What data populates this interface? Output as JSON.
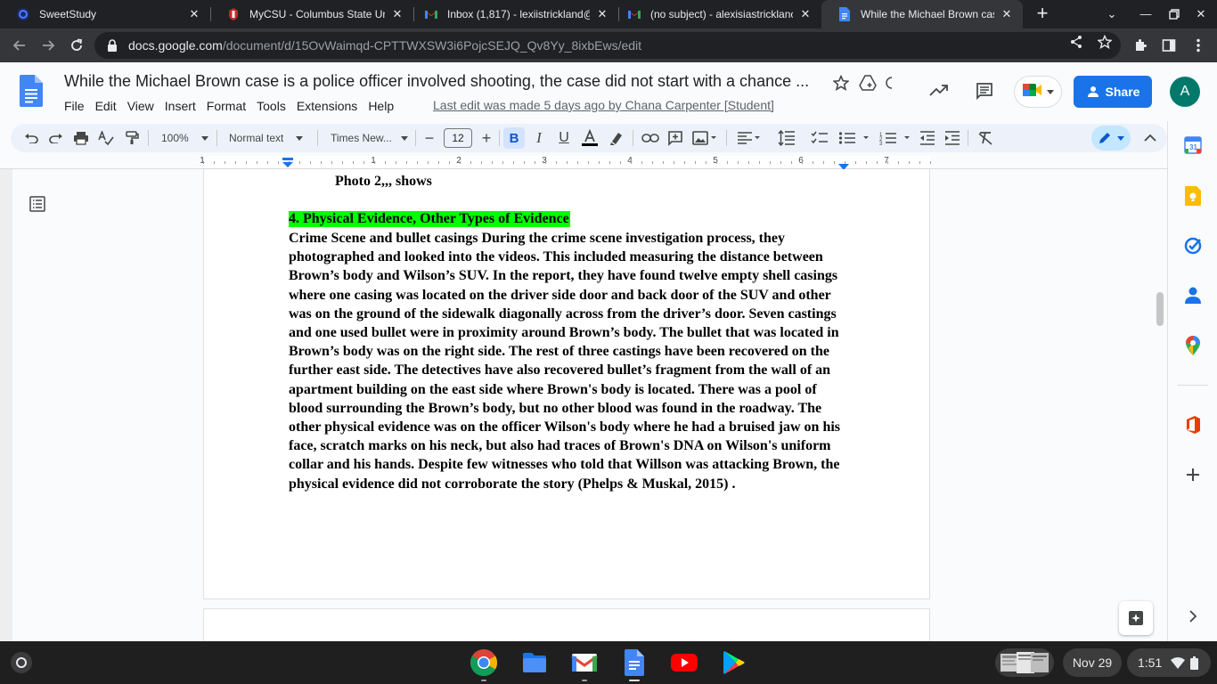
{
  "browser": {
    "tabs": [
      {
        "title": "SweetStudy",
        "icon": "sweetstudy-icon",
        "active": false
      },
      {
        "title": "MyCSU - Columbus State Univ",
        "icon": "csu-icon",
        "active": false
      },
      {
        "title": "Inbox (1,817) - lexiistrickland@",
        "icon": "gmail-icon",
        "active": false
      },
      {
        "title": "(no subject) - alexisiastricklanc",
        "icon": "gmail-icon",
        "active": false
      },
      {
        "title": "While the Michael Brown case",
        "icon": "docs-icon",
        "active": true
      }
    ],
    "url_host": "docs.google.com",
    "url_path": "/document/d/15OvWaimqd-CPTTWXSW3i6PojcSEJQ_Qv8Yy_8ixbEws/edit"
  },
  "docs": {
    "title": "While the Michael Brown case is a police officer involved shooting, the case did not start with a chance ...",
    "menu": [
      "File",
      "Edit",
      "View",
      "Insert",
      "Format",
      "Tools",
      "Extensions",
      "Help"
    ],
    "last_edit": "Last edit was made 5 days ago by Chana Carpenter [Student]",
    "share_label": "Share",
    "avatar_letter": "A",
    "toolbar": {
      "zoom": "100%",
      "style": "Normal text",
      "font": "Times New...",
      "font_size": "12",
      "bold": "B",
      "italic": "I",
      "underline": "U"
    },
    "ruler_numbers": [
      "1",
      "1",
      "2",
      "3",
      "4",
      "5",
      "6",
      "7"
    ]
  },
  "document": {
    "photo_line": "Photo 2,,, shows",
    "heading": "4. Physical Evidence, Other Types of Evidence",
    "body_lines": [
      "Crime Scene and bullet casings During the crime scene investigation process, they",
      "photographed and looked into the videos. This included measuring the distance between",
      "Brown’s body and Wilson’s SUV.  In the report, they have found twelve empty shell casings",
      "where one casing was located on the driver side door and back door of the SUV and other",
      "was on the ground of the sidewalk diagonally across from the driver’s door. Seven castings",
      "and one used bullet were in proximity around Brown’s body. The bullet that was located in",
      "Brown’s body was on the right side. The rest of three castings have been recovered on the",
      "further east side. The detectives have also recovered bullet’s fragment from the wall of an",
      "apartment building on the east side where Brown's body is located. There was a pool of",
      "blood surrounding the Brown’s body, but no other blood was found in the roadway. The",
      "other physical evidence was on the officer Wilson's body where he had a bruised jaw on his",
      "face,  scratch marks on his neck, but also had traces of Brown's DNA on Wilson's uniform",
      "collar and his hands. Despite few witnesses who told that Willson was attacking Brown, the",
      "physical evidence did not corroborate the story (Phelps & Muskal, 2015) ."
    ],
    "heading_highlight_color": "#00ff00"
  },
  "shelf": {
    "apps": [
      "chrome-icon",
      "files-icon",
      "gmail-icon",
      "docs-icon",
      "youtube-icon",
      "play-store-icon"
    ],
    "date": "Nov 29",
    "time": "1:51"
  },
  "colors": {
    "docs_blue": "#1a73e8",
    "chrome_dark": "#202124",
    "active_tab": "#35363a",
    "avatar_bg": "#00796b",
    "toolbar_bg": "#edf2fa"
  }
}
